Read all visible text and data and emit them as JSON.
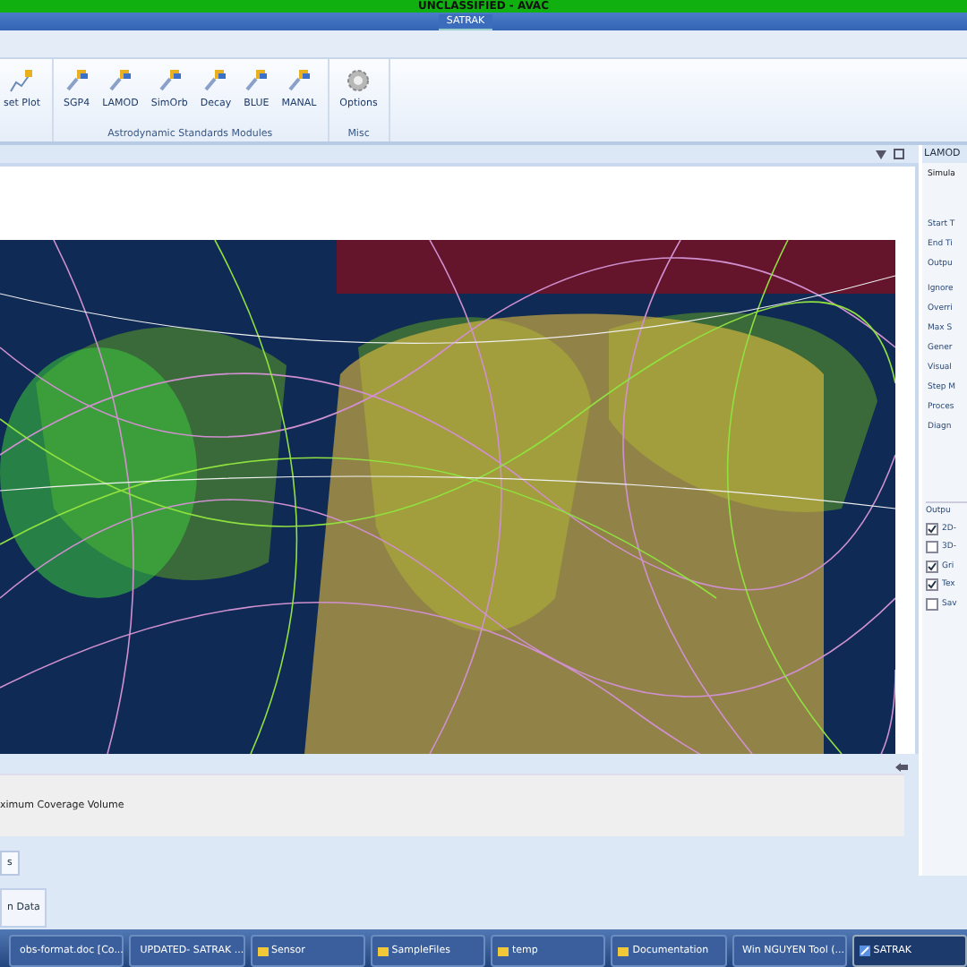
{
  "classification_bar": {
    "text": "UNCLASSIFIED - AVAC"
  },
  "title_bar": {
    "tab": "SATRAK"
  },
  "ribbon": {
    "partial_button": "set Plot",
    "groups": [
      {
        "label": "Astrodynamic Standards Modules",
        "buttons": [
          "SGP4",
          "LAMOD",
          "SimOrb",
          "Decay",
          "BLUE",
          "MANAL"
        ]
      },
      {
        "label": "Misc",
        "buttons": [
          "Options"
        ]
      }
    ]
  },
  "side_panel": {
    "title": "LAMOD",
    "fields": [
      "Simula",
      "Start T",
      "End Ti",
      "Outpu",
      "Ignore",
      "Overri",
      "Max S",
      "Gener",
      "Visual",
      "Step M",
      "Proces",
      "Diagn"
    ],
    "output_group": {
      "title": "Outpu",
      "options": [
        {
          "label": "2D-",
          "checked": true
        },
        {
          "label": "3D-",
          "checked": false
        },
        {
          "label": "Gri",
          "checked": true
        },
        {
          "label": "Tex",
          "checked": true
        },
        {
          "label": "Sav",
          "checked": false
        }
      ]
    }
  },
  "bottom_panel": {
    "text": "ximum Coverage Volume",
    "tab": "s"
  },
  "footer_button": "n Data",
  "taskbar": [
    {
      "label": "obs-format.doc [Co...",
      "kind": "doc",
      "selected": false
    },
    {
      "label": "UPDATED- SATRAK ...",
      "kind": "doc",
      "selected": false
    },
    {
      "label": "Sensor",
      "kind": "folder",
      "selected": false
    },
    {
      "label": "SampleFiles",
      "kind": "folder",
      "selected": false
    },
    {
      "label": "temp",
      "kind": "folder",
      "selected": false
    },
    {
      "label": "Documentation",
      "kind": "folder",
      "selected": false
    },
    {
      "label": "Win NGUYEN Tool (...",
      "kind": "app",
      "selected": false
    },
    {
      "label": "SATRAK",
      "kind": "app",
      "selected": true
    }
  ]
}
